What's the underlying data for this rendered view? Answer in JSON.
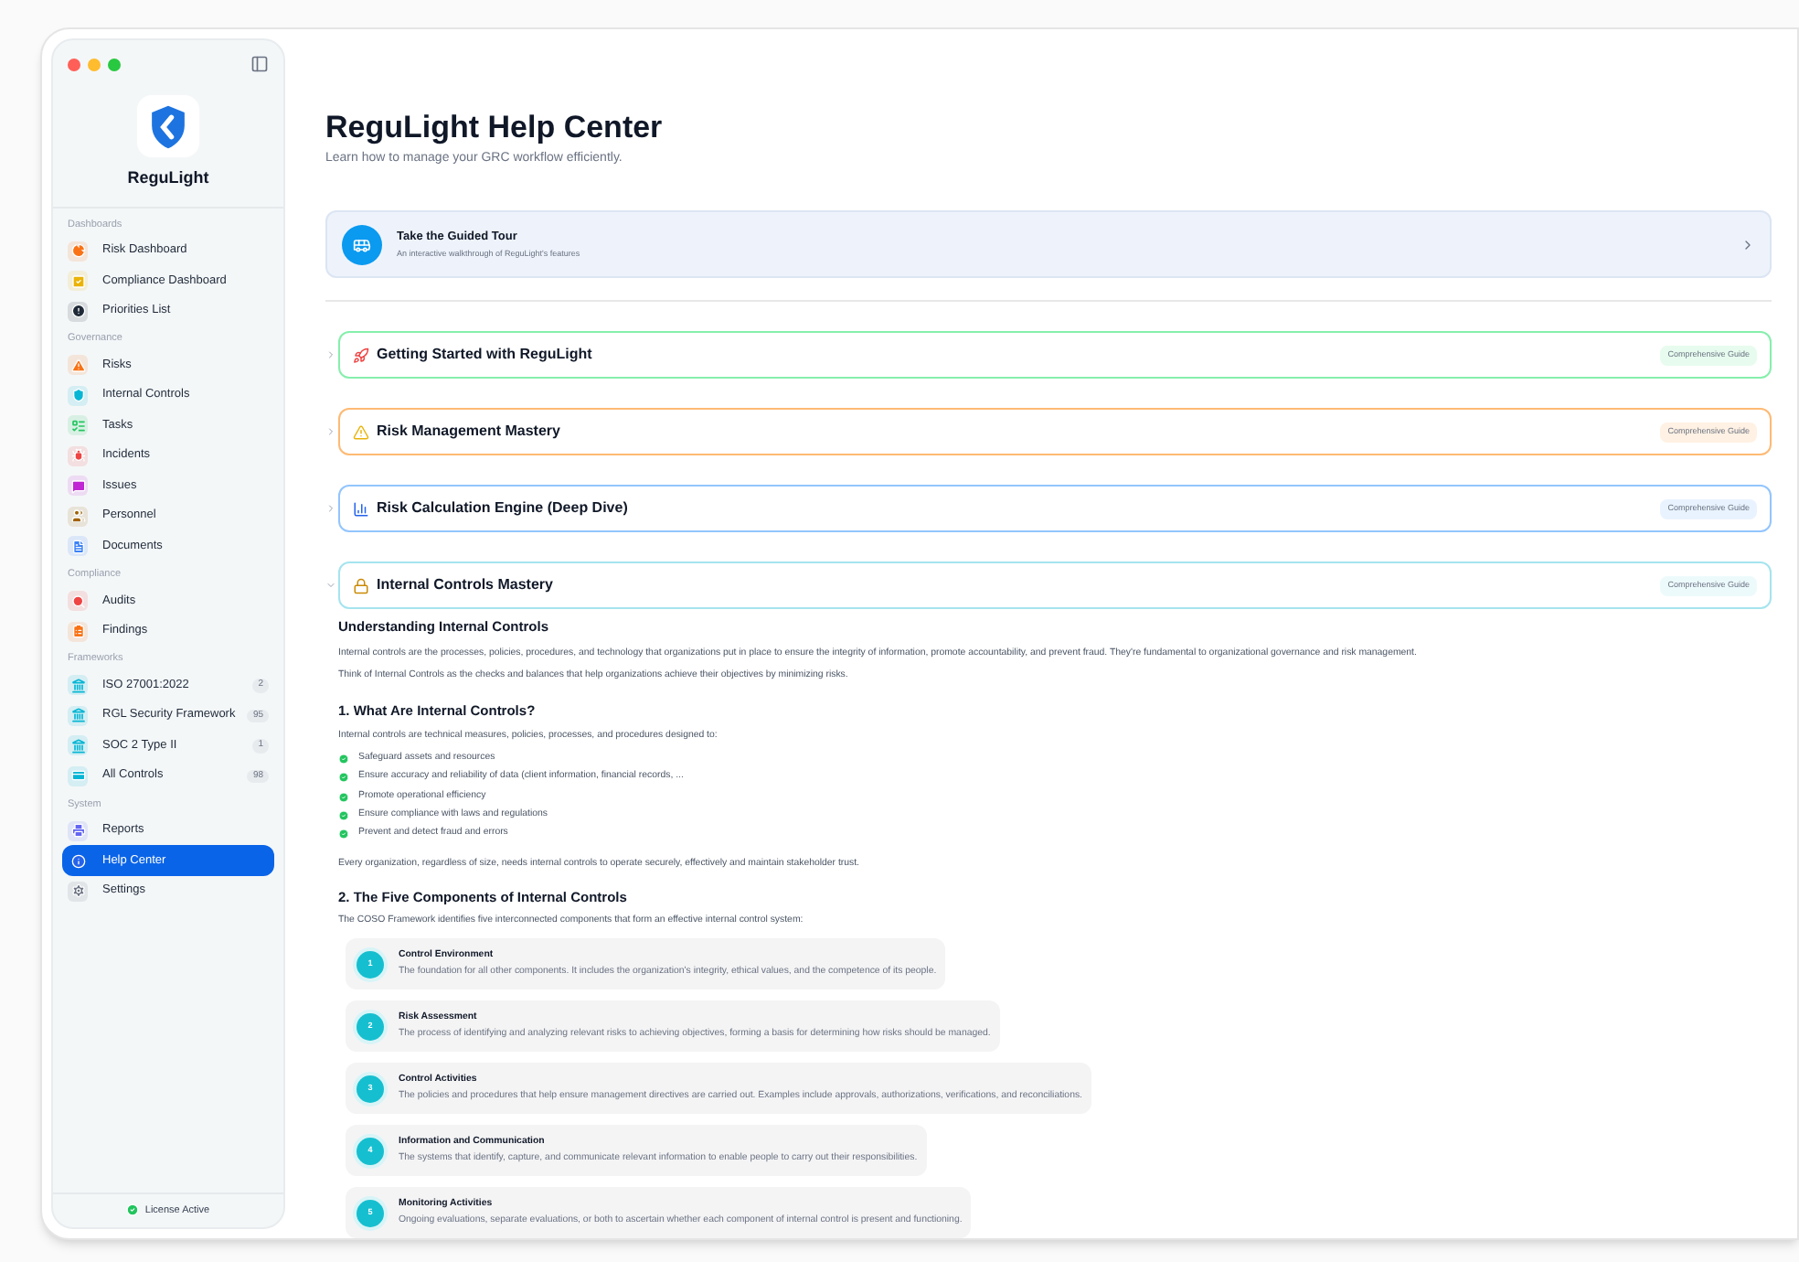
{
  "sidebar": {
    "app_name": "ReguLight",
    "sections": [
      {
        "title": "Dashboards",
        "items": [
          {
            "label": "Risk Dashboard",
            "color": "#f97316",
            "selected": false
          },
          {
            "label": "Compliance Dashboard",
            "color": "#eab308",
            "selected": false
          },
          {
            "label": "Priorities List",
            "color": "#1f2937",
            "selected": false
          }
        ]
      },
      {
        "title": "Governance",
        "items": [
          {
            "label": "Risks",
            "color": "#f97316",
            "selected": false
          },
          {
            "label": "Internal Controls",
            "color": "#06b6d4",
            "selected": false
          },
          {
            "label": "Tasks",
            "color": "#22c55e",
            "selected": false
          },
          {
            "label": "Incidents",
            "color": "#ef4444",
            "selected": false
          },
          {
            "label": "Issues",
            "color": "#c026d3",
            "selected": false
          },
          {
            "label": "Personnel",
            "color": "#a16207",
            "selected": false
          },
          {
            "label": "Documents",
            "color": "#3b82f6",
            "selected": false
          }
        ]
      },
      {
        "title": "Compliance",
        "items": [
          {
            "label": "Audits",
            "color": "#ef4444",
            "selected": false
          },
          {
            "label": "Findings",
            "color": "#f97316",
            "selected": false
          }
        ]
      },
      {
        "title": "Frameworks",
        "items": [
          {
            "label": "ISO 27001:2022",
            "color": "#06b6d4",
            "selected": false,
            "count": "2"
          },
          {
            "label": "RGL Security Framework",
            "color": "#06b6d4",
            "selected": false,
            "count": "95"
          },
          {
            "label": "SOC 2 Type II",
            "color": "#06b6d4",
            "selected": false,
            "count": "1"
          },
          {
            "label": "All Controls",
            "color": "#06b6d4",
            "selected": false,
            "count": "98"
          }
        ]
      },
      {
        "title": "System",
        "items": [
          {
            "label": "Reports",
            "color": "#6366f1",
            "selected": false
          },
          {
            "label": "Help Center",
            "color": "#2563eb",
            "selected": true
          },
          {
            "label": "Settings",
            "color": "#6b7280",
            "selected": false
          }
        ]
      }
    ],
    "license": "License Active"
  },
  "main": {
    "title": "ReguLight Help Center",
    "subtitle": "Learn how to manage your GRC workflow efficiently.",
    "tour": {
      "title": "Take the Guided Tour",
      "description": "An interactive walkthrough of ReguLight's features"
    },
    "guides": [
      {
        "title": "Getting Started with ReguLight",
        "badge": "Comprehensive Guide",
        "color": "#86efac",
        "expanded": false
      },
      {
        "title": "Risk Management Mastery",
        "badge": "Comprehensive Guide",
        "color": "#fdba74",
        "expanded": false
      },
      {
        "title": "Risk Calculation Engine (Deep Dive)",
        "badge": "Comprehensive Guide",
        "color": "#93c5fd",
        "expanded": false
      },
      {
        "title": "Internal Controls Mastery",
        "badge": "Comprehensive Guide",
        "color": "#a5e4ee",
        "expanded": true
      }
    ],
    "content": {
      "heading": "Understanding Internal Controls",
      "paragraphs": [
        "Internal controls are the processes, policies, procedures, and technology that organizations put in place to ensure the integrity of information, promote accountability, and prevent fraud. They're fundamental to organizational governance and risk management.",
        "Think of Internal Controls as the checks and balances that help organizations achieve their objectives by minimizing risks."
      ],
      "section_1": {
        "heading": "1. What Are Internal Controls?",
        "intro": "Internal controls are technical measures, policies, processes, and procedures designed to:",
        "bullets": [
          "Safeguard assets and resources",
          "Ensure accuracy and reliability of data (client information, financial records, ...",
          "Promote operational efficiency",
          "Ensure compliance with laws and regulations",
          "Prevent and detect fraud and errors"
        ],
        "outro": "Every organization, regardless of size, needs internal controls to operate securely, effectively and maintain stakeholder trust."
      },
      "section_2": {
        "heading": "2. The Five Components of Internal Controls",
        "intro": "The COSO Framework identifies five interconnected components that form an effective internal control system:",
        "components": [
          {
            "number": "1",
            "title": "Control Environment",
            "description": "The foundation for all other components. It includes the organization's integrity, ethical values, and the competence of its people."
          },
          {
            "number": "2",
            "title": "Risk Assessment",
            "description": "The process of identifying and analyzing relevant risks to achieving objectives, forming a basis for determining how risks should be managed."
          },
          {
            "number": "3",
            "title": "Control Activities",
            "description": "The policies and procedures that help ensure management directives are carried out. Examples include approvals, authorizations, verifications, and reconciliations."
          },
          {
            "number": "4",
            "title": "Information and Communication",
            "description": "The systems that identify, capture, and communicate relevant information to enable people to carry out their responsibilities."
          },
          {
            "number": "5",
            "title": "Monitoring Activities",
            "description": "Ongoing evaluations, separate evaluations, or both to ascertain whether each component of internal control is present and functioning."
          }
        ]
      }
    }
  }
}
